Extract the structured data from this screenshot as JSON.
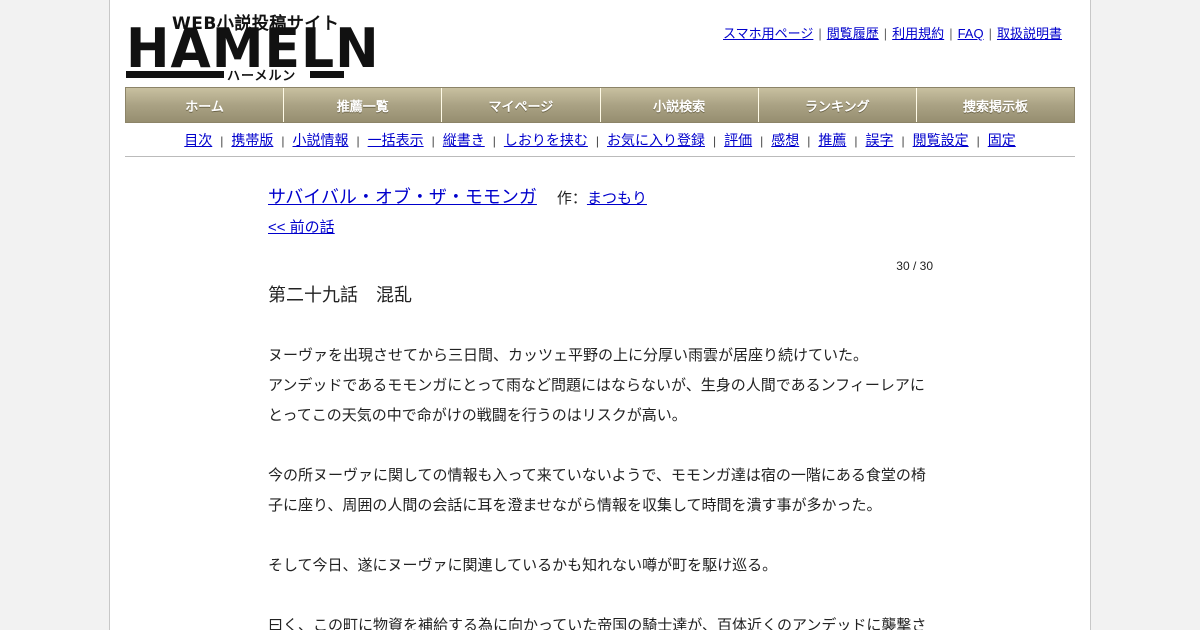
{
  "logo": {
    "tagline": "WEB小説投稿サイト",
    "brand": "HAMELN",
    "kana": "ハーメルン"
  },
  "top_links": [
    "スマホ用ページ",
    "閲覧履歴",
    "利用規約",
    "FAQ",
    "取扱説明書"
  ],
  "main_nav": [
    "ホーム",
    "推薦一覧",
    "マイページ",
    "小説検索",
    "ランキング",
    "捜索掲示板"
  ],
  "sub_nav": [
    "目次",
    "携帯版",
    "小説情報",
    "一括表示",
    "縦書き",
    "しおりを挟む",
    "お気に入り登録",
    "評価",
    "感想",
    "推薦",
    "誤字",
    "閲覧設定",
    "固定"
  ],
  "novel": {
    "title": "サバイバル・オブ・ザ・モモンガ",
    "author_label": "作：",
    "author": "まつもり",
    "prev_link": "<< 前の話",
    "page_count": "30 / 30",
    "chapter_title": "第二十九話　混乱"
  },
  "body_paragraphs": [
    "ヌーヴァを出現させてから三日間、カッツェ平野の上に分厚い雨雲が居座り続けていた。",
    "アンデッドであるモモンガにとって雨など問題にはならないが、生身の人間であるンフィーレアにとってこの天気の中で命がけの戦闘を行うのはリスクが高い。",
    "",
    "今の所ヌーヴァに関しての情報も入って来ていないようで、モモンガ達は宿の一階にある食堂の椅子に座り、周囲の人間の会話に耳を澄ませながら情報を収集して時間を潰す事が多かった。",
    "",
    "そして今日、遂にヌーヴァに関連しているかも知れない噂が町を駆け巡る。",
    "",
    "曰く、この町に物資を補給する為に向かっていた帝国の騎士達が、百体近くのアンデッドに襲撃さ"
  ]
}
